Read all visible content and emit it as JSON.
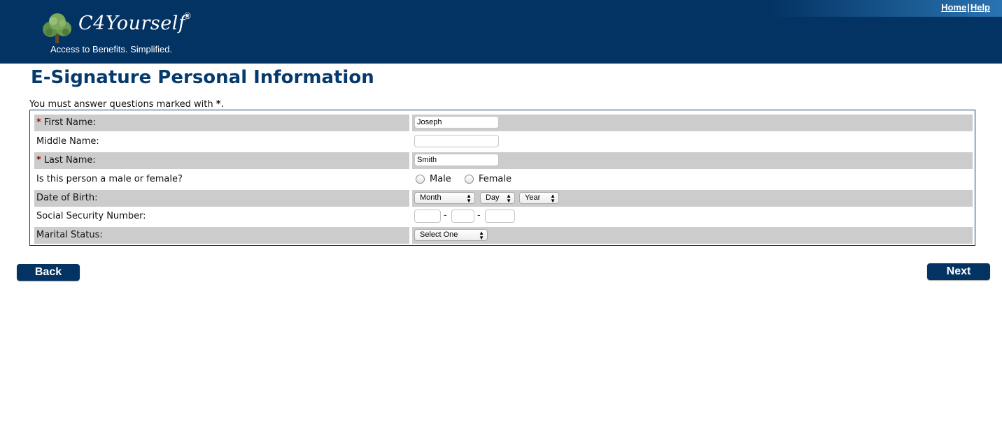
{
  "header": {
    "logo_name": "C4Yourself",
    "logo_reg": "®",
    "tagline": "Access to Benefits.  Simplified.",
    "links": [
      "Home",
      "Help"
    ],
    "link_separator": "|"
  },
  "page": {
    "title": "E-Signature Personal Information",
    "required_note": "You must answer questions marked with ",
    "required_mark": "*",
    "required_note_end": "."
  },
  "form": {
    "first_name": {
      "label": "First Name:",
      "required": "*",
      "value": "Joseph"
    },
    "middle_name": {
      "label": "Middle Name:",
      "value": ""
    },
    "last_name": {
      "label": "Last Name:",
      "required": "*",
      "value": "Smith"
    },
    "gender": {
      "label": "Is this person a male or female?",
      "options": [
        "Male",
        "Female"
      ]
    },
    "dob": {
      "label": "Date of Birth:",
      "month": "Month",
      "day": "Day",
      "year": "Year"
    },
    "ssn": {
      "label": "Social Security Number:",
      "separator": "-"
    },
    "marital": {
      "label": "Marital Status:",
      "value": "Select One"
    }
  },
  "buttons": {
    "back": "Back",
    "next": "Next"
  },
  "colors": {
    "header": "#033363",
    "title": "#063a6d",
    "row_shade": "#cccccc",
    "required": "#8b1010"
  }
}
